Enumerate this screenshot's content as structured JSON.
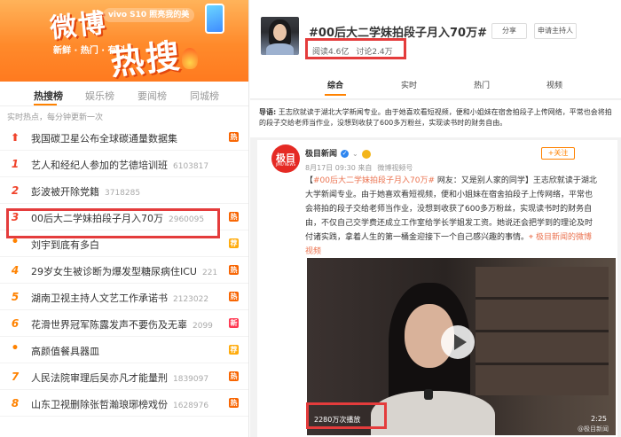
{
  "banner": {
    "title_part1": "微博",
    "title_part2": "热搜",
    "tagline": "新鲜 · 热门 · 有料",
    "vivo_ad": "vivo S10 照亮我的美"
  },
  "tabs": [
    "热搜榜",
    "娱乐榜",
    "要闻榜",
    "同城榜"
  ],
  "subhint": "实时热点，每分钟更新一次",
  "hot_list": [
    {
      "rank": "",
      "title": "我国碳卫星公布全球碳通量数据集",
      "count": "",
      "badge": "热"
    },
    {
      "rank": "1",
      "title": "艺人和经纪人参加的艺德培训班",
      "count": "6103817",
      "badge": ""
    },
    {
      "rank": "2",
      "title": "彭波被开除党籍",
      "count": "3718285",
      "badge": ""
    },
    {
      "rank": "3",
      "title": "00后大二学妹拍段子月入70万",
      "count": "2960095",
      "badge": "热"
    },
    {
      "rank": "•",
      "title": "刘宇到底有多白",
      "count": "",
      "badge": "荐"
    },
    {
      "rank": "4",
      "title": "29岁女生被诊断为爆发型糖尿病住ICU",
      "count": "221",
      "badge": "热"
    },
    {
      "rank": "5",
      "title": "湖南卫视主持人文艺工作承诺书",
      "count": "2123022",
      "badge": "热"
    },
    {
      "rank": "6",
      "title": "花滑世界冠军陈露发声不要伤及无辜",
      "count": "2099",
      "badge": "新"
    },
    {
      "rank": "•",
      "title": "高颜值餐具器皿",
      "count": "",
      "badge": "荐"
    },
    {
      "rank": "7",
      "title": "人民法院审理后吴亦凡才能量刑",
      "count": "1839097",
      "badge": "热"
    },
    {
      "rank": "8",
      "title": "山东卫视删除张哲瀚琅琊榜戏份",
      "count": "1628976",
      "badge": "热"
    }
  ],
  "topic": {
    "title": "#00后大二学妹拍段子月入70万#",
    "share_label": "分享",
    "host_label": "申请主持人",
    "reads": "阅读4.6亿",
    "discussions": "讨论2.4万"
  },
  "topic_tabs": [
    "综合",
    "实时",
    "热门",
    "视频"
  ],
  "guide": {
    "label": "导语:",
    "text": "王志欣就读于湖北大学新闻专业。由于她喜欢看短视频，便和小姐妹在宿舍拍段子上传网络，平常也会将拍的段子交给老师当作业，没想到收获了600多万粉丝，实现读书时的财务自由。"
  },
  "post": {
    "avatar_text": "极目",
    "avatar_sub": "JIMU NEWS",
    "author": "极目新闻",
    "time": "8月17日 09:30 来自",
    "source": "微博视频号",
    "follow_label": "+关注",
    "topic_tag": "#00后大二学妹拍段子月入70万#",
    "text": " 网友：又是别人家的同学】王志欣就读于湖北大学新闻专业。由于她喜欢看短视频，便和小姐妹在宿舍拍段子上传网络，平常也会将拍的段子交给老师当作业，没想到收获了600多万粉丝，实现读书时的财务自由，不仅自己交学费还成立工作室给学长学姐发工资。她说还会把学到的理论及时付诸实践，拿着人生的第一桶金迎接下一个自己感兴趣的事情。",
    "link": "极目新闻的微博视频"
  },
  "video": {
    "plays": "2280万次播放",
    "duration": "2:25",
    "watermark": "@极目新闻"
  },
  "colors": {
    "accent": "#ff8200",
    "highlight_box": "#e43c3c",
    "rank_red": "#f0442c",
    "link": "#eb7350"
  }
}
